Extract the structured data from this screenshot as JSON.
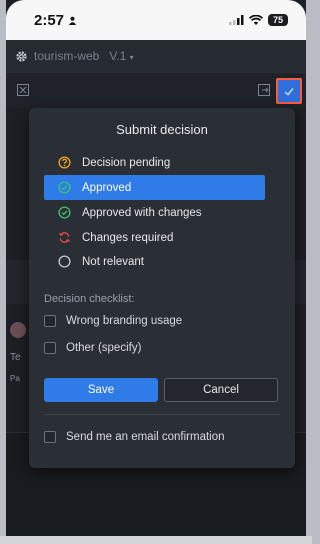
{
  "status_bar": {
    "time": "2:57",
    "battery": "75"
  },
  "app": {
    "name": "tourism-web",
    "version": "V.1"
  },
  "background": {
    "frag_te": "Te",
    "frag_pa": "Pa"
  },
  "popover": {
    "title": "Submit decision",
    "options": [
      {
        "label": "Decision pending",
        "icon": "question-circle-icon",
        "color": "#f5a623"
      },
      {
        "label": "Approved",
        "icon": "check-circle-icon",
        "color": "#ffffff",
        "selected": true
      },
      {
        "label": "Approved with changes",
        "icon": "check-circle-icon",
        "color": "#3ec46d"
      },
      {
        "label": "Changes required",
        "icon": "refresh-icon",
        "color": "#e8474a"
      },
      {
        "label": "Not relevant",
        "icon": "empty-circle-icon",
        "color": "#c7cbd1"
      }
    ],
    "checklist_label": "Decision checklist:",
    "checklist": [
      {
        "label": "Wrong branding usage",
        "checked": false
      },
      {
        "label": "Other (specify)",
        "checked": false
      }
    ],
    "save_label": "Save",
    "cancel_label": "Cancel",
    "email_confirmation": {
      "label": "Send me an email confirmation",
      "checked": false
    }
  },
  "colors": {
    "accent": "#2f7be8",
    "highlight_border": "#ff5a3c"
  }
}
